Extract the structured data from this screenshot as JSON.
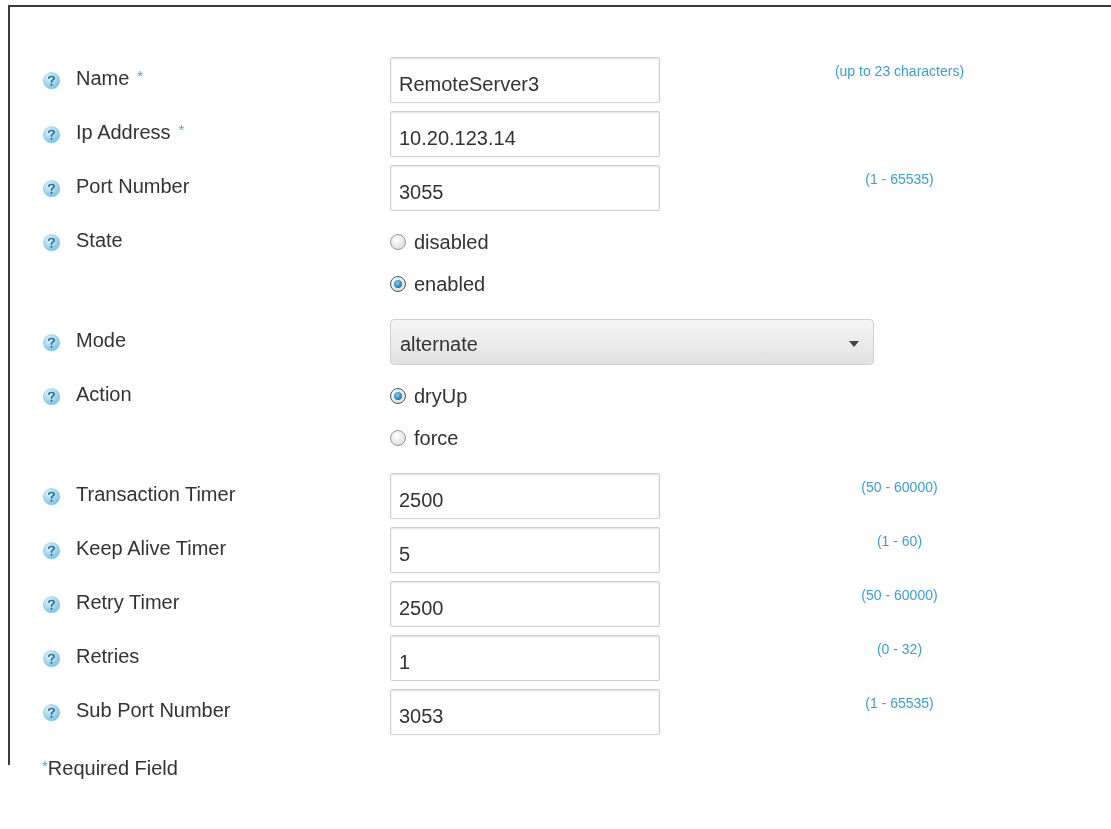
{
  "fields": [
    {
      "kind": "text",
      "label": "Name",
      "required_mark": "*",
      "value": "RemoteServer3",
      "hint": "(up to 23 characters)"
    },
    {
      "kind": "text",
      "label": "Ip Address",
      "required_mark": "*",
      "value": "10.20.123.14"
    },
    {
      "kind": "text",
      "label": "Port Number",
      "value": "3055",
      "hint": "(1 - 65535)"
    },
    {
      "kind": "radio",
      "label": "State",
      "options": [
        {
          "label": "disabled",
          "selected": false
        },
        {
          "label": "enabled",
          "selected": true
        }
      ]
    },
    {
      "kind": "select",
      "label": "Mode",
      "value": "alternate"
    },
    {
      "kind": "radio",
      "label": "Action",
      "options": [
        {
          "label": "dryUp",
          "selected": true
        },
        {
          "label": "force",
          "selected": false
        }
      ]
    },
    {
      "kind": "text",
      "label": "Transaction Timer",
      "value": "2500",
      "hint": "(50 - 60000)"
    },
    {
      "kind": "text",
      "label": "Keep Alive Timer",
      "value": "5",
      "hint": "(1 - 60)"
    },
    {
      "kind": "text",
      "label": "Retry Timer",
      "value": "2500",
      "hint": "(50 - 60000)"
    },
    {
      "kind": "text",
      "label": "Retries",
      "value": "1",
      "hint": "(0 - 32)"
    },
    {
      "kind": "text",
      "label": "Sub Port Number",
      "value": "3053",
      "hint": "(1 - 65535)"
    }
  ],
  "required_note": {
    "mark": "*",
    "text": "Required Field"
  }
}
